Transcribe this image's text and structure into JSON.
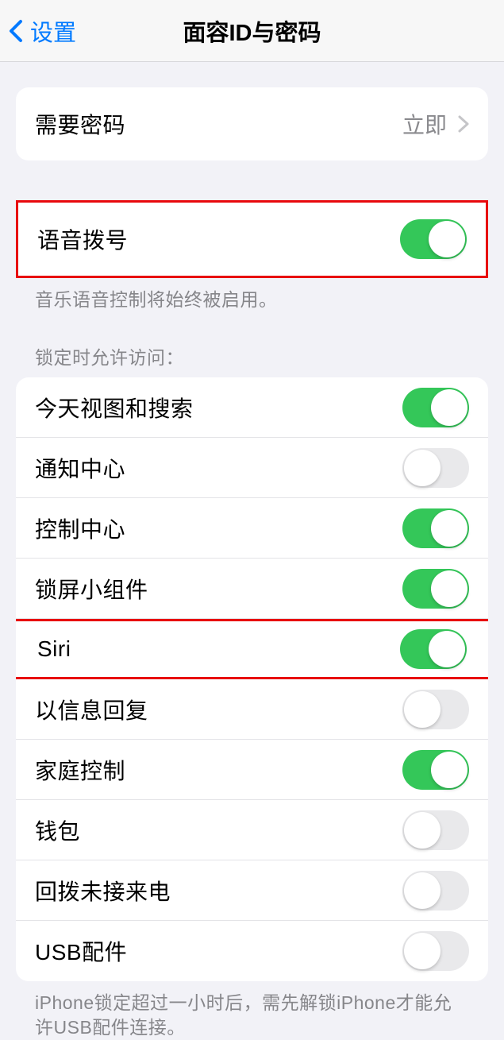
{
  "nav": {
    "back_label": "设置",
    "title": "面容ID与密码"
  },
  "passcode_row": {
    "label": "需要密码",
    "value": "立即"
  },
  "voice_dial": {
    "label": "语音拨号",
    "footer": "音乐语音控制将始终被启用。"
  },
  "lock_access": {
    "header": "锁定时允许访问：",
    "items": [
      {
        "label": "今天视图和搜索",
        "on": true
      },
      {
        "label": "通知中心",
        "on": false
      },
      {
        "label": "控制中心",
        "on": true
      },
      {
        "label": "锁屏小组件",
        "on": true
      },
      {
        "label": "Siri",
        "on": true,
        "highlight": true
      },
      {
        "label": "以信息回复",
        "on": false
      },
      {
        "label": "家庭控制",
        "on": true
      },
      {
        "label": "钱包",
        "on": false
      },
      {
        "label": "回拨未接来电",
        "on": false
      },
      {
        "label": "USB配件",
        "on": false
      }
    ],
    "footer": "iPhone锁定超过一小时后，需先解锁iPhone才能允许USB配件连接。"
  }
}
